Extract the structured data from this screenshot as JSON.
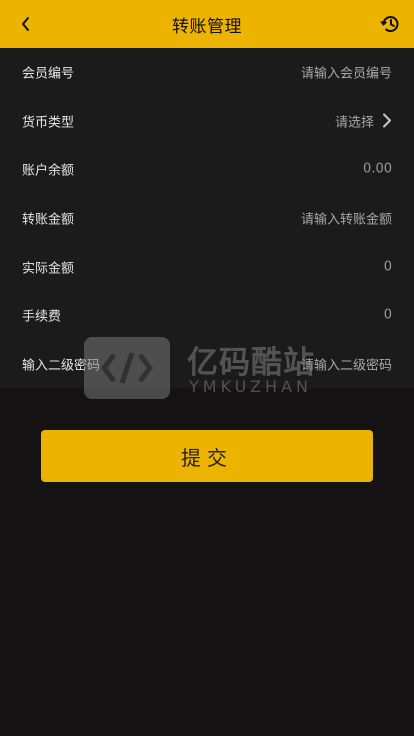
{
  "header": {
    "title": "转账管理"
  },
  "form": {
    "rows": [
      {
        "label": "会员编号",
        "value": "请输入会员编号"
      },
      {
        "label": "货币类型",
        "value": "请选择"
      },
      {
        "label": "账户余额",
        "value": "0.00"
      },
      {
        "label": "转账金额",
        "value": "请输入转账金额"
      },
      {
        "label": "实际金额",
        "value": "0"
      },
      {
        "label": "手续费",
        "value": "0"
      },
      {
        "label": "输入二级密码",
        "value": "请输入二级密码"
      }
    ]
  },
  "watermark": {
    "cn": "亿码酷站",
    "en": "YMKUZHAN"
  },
  "submit": {
    "label": "提交"
  },
  "colors": {
    "accent": "#ecb400",
    "background": "#141213",
    "form_background": "#1b1b1b"
  },
  "icons": [
    "back-icon",
    "history-icon",
    "chevron-right-icon"
  ]
}
